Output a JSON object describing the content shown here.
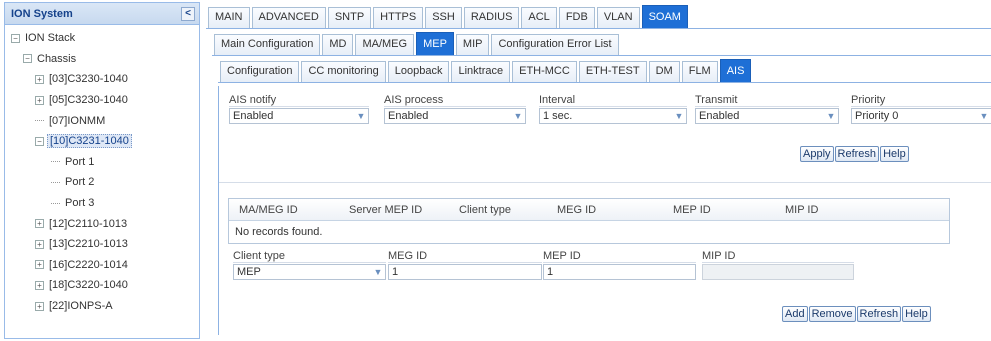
{
  "sidebar": {
    "title": "ION System",
    "collapse_glyph": "<",
    "tree": [
      {
        "label": "ION Stack",
        "level": 0,
        "exp": "−"
      },
      {
        "label": "Chassis",
        "level": 1,
        "exp": "−"
      },
      {
        "label": "[03]C3230-1040",
        "level": 2,
        "exp": "+"
      },
      {
        "label": "[05]C3230-1040",
        "level": 2,
        "exp": "+"
      },
      {
        "label": "[07]IONMM",
        "level": 2,
        "exp": ""
      },
      {
        "label": "[10]C3231-1040",
        "level": 2,
        "exp": "−",
        "selected": true
      },
      {
        "label": "Port 1",
        "level": 3,
        "exp": ""
      },
      {
        "label": "Port 2",
        "level": 3,
        "exp": ""
      },
      {
        "label": "Port 3",
        "level": 3,
        "exp": ""
      },
      {
        "label": "[12]C2110-1013",
        "level": 2,
        "exp": "+"
      },
      {
        "label": "[13]C2210-1013",
        "level": 2,
        "exp": "+"
      },
      {
        "label": "[16]C2220-1014",
        "level": 2,
        "exp": "+"
      },
      {
        "label": "[18]C3220-1040",
        "level": 2,
        "exp": "+"
      },
      {
        "label": "[22]IONPS-A",
        "level": 2,
        "exp": "+"
      }
    ]
  },
  "top_tabs": [
    "MAIN",
    "ADVANCED",
    "SNTP",
    "HTTPS",
    "SSH",
    "RADIUS",
    "ACL",
    "FDB",
    "VLAN",
    "SOAM"
  ],
  "top_tabs_active": 9,
  "second_tabs": [
    "Main Configuration",
    "MD",
    "MA/MEG",
    "MEP",
    "MIP",
    "Configuration Error List"
  ],
  "second_tabs_active": 3,
  "third_tabs": [
    "Configuration",
    "CC monitoring",
    "Loopback",
    "Linktrace",
    "ETH-MCC",
    "ETH-TEST",
    "DM",
    "FLM",
    "AIS"
  ],
  "third_tabs_active": 8,
  "ais_form": {
    "notify": {
      "label": "AIS notify",
      "value": "Enabled"
    },
    "process": {
      "label": "AIS process",
      "value": "Enabled"
    },
    "interval": {
      "label": "Interval",
      "value": "1 sec."
    },
    "transmit": {
      "label": "Transmit",
      "value": "Enabled"
    },
    "priority": {
      "label": "Priority",
      "value": "Priority 0"
    }
  },
  "buttons_top": {
    "apply": "Apply",
    "refresh": "Refresh",
    "help": "Help"
  },
  "grid": {
    "columns": [
      "MA/MEG ID",
      "Server MEP ID",
      "Client type",
      "MEG ID",
      "MEP ID",
      "MIP ID"
    ],
    "empty_text": "No records found."
  },
  "client_form": {
    "client_type": {
      "label": "Client type",
      "value": "MEP"
    },
    "meg_id": {
      "label": "MEG ID",
      "value": "1"
    },
    "mep_id": {
      "label": "MEP ID",
      "value": "1"
    },
    "mip_id": {
      "label": "MIP ID",
      "value": ""
    }
  },
  "buttons_bottom": {
    "add": "Add",
    "remove": "Remove",
    "refresh": "Refresh",
    "help": "Help"
  }
}
